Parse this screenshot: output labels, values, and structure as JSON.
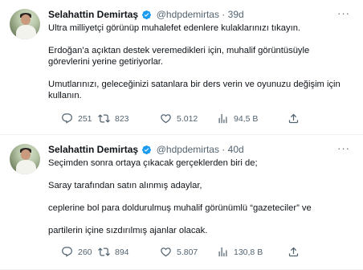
{
  "tweets": [
    {
      "name": "Selahattin Demirtaş",
      "handle": "@hdpdemirtas",
      "dot": "·",
      "time": "39d",
      "lines": [
        "Ultra milliyetçi görünüp muhalefet edenlere kulaklarınızı tıkayın.",
        "Erdoğan’a açıktan destek veremedikleri için, muhalif görüntüsüyle",
        "görevlerini yerine getiriyorlar.",
        "Umutlarınızı, geleceğinizi satanlara bir ders verin ve oyunuzu değişim için",
        "kullanın."
      ],
      "replies": "251",
      "retweets": "823",
      "likes": "5.012",
      "views": "94,5 B"
    },
    {
      "name": "Selahattin Demirtaş",
      "handle": "@hdpdemirtas",
      "dot": "·",
      "time": "40d",
      "lines": [
        "Seçimden sonra ortaya çıkacak gerçeklerden biri de;",
        "Saray tarafından satın alınmış adaylar,",
        "ceplerine bol para doldurulmuş muhalif görünümlü “gazeteciler” ve",
        "partilerin içine sızdırılmış ajanlar olacak."
      ],
      "replies": "260",
      "retweets": "894",
      "likes": "5.807",
      "views": "130,8 B"
    }
  ],
  "icons": {
    "verified": "verified-badge-icon",
    "more": "more-options-icon",
    "reply": "reply-icon",
    "retweet": "retweet-icon",
    "like": "like-icon",
    "views": "views-icon",
    "share": "share-icon"
  },
  "colors": {
    "text": "#0f1419",
    "secondary": "#536471",
    "verified": "#1d9bf0"
  }
}
